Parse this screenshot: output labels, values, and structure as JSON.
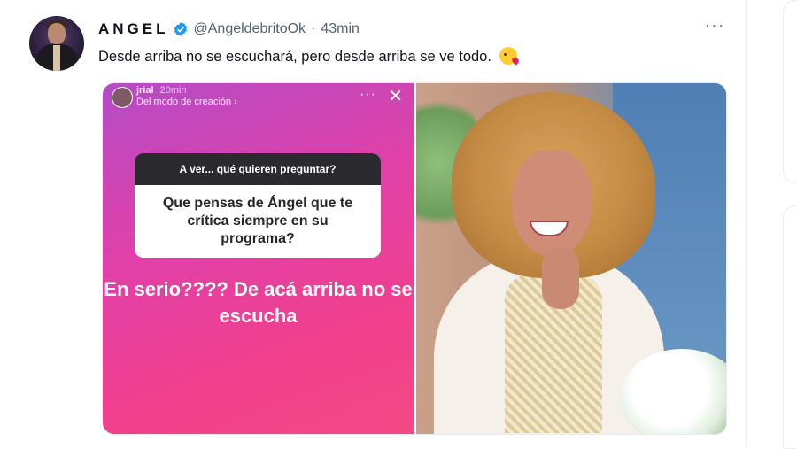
{
  "tweet": {
    "display_name": "ANGEL",
    "handle": "@AngeldebritoOk",
    "separator": "·",
    "time": "43min",
    "more_label": "···",
    "text": "Desde arriba no se escuchará, pero desde arriba se ve todo.",
    "emoji_icon": "face-blowing-kiss-icon",
    "verified_icon": "verified-badge-icon"
  },
  "media": {
    "story": {
      "user": "jrial",
      "time": "20min",
      "subtitle": "Del modo de creación ›",
      "more_label": "···",
      "close_label": "✕",
      "question_header": "A ver... qué quieren preguntar?",
      "question": "Que pensas de Ángel que te crítica siempre en su programa?",
      "answer": "En serio???? De acá arriba no se escucha"
    }
  },
  "colors": {
    "verified": "#1d9bf0",
    "story_gradient_start": "#b44cc6",
    "story_gradient_end": "#f24a84"
  }
}
